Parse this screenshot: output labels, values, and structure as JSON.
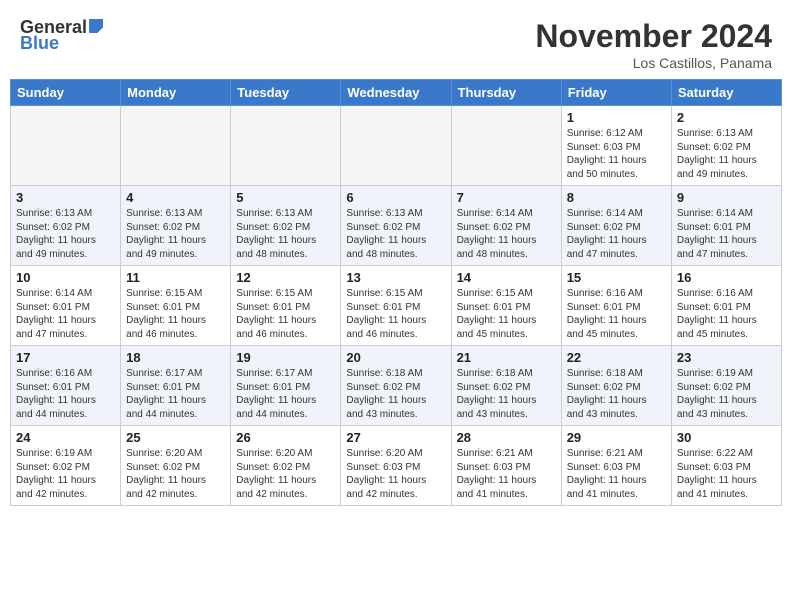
{
  "header": {
    "logo_general": "General",
    "logo_blue": "Blue",
    "month": "November 2024",
    "location": "Los Castillos, Panama"
  },
  "days_of_week": [
    "Sunday",
    "Monday",
    "Tuesday",
    "Wednesday",
    "Thursday",
    "Friday",
    "Saturday"
  ],
  "weeks": [
    [
      {
        "day": "",
        "info": ""
      },
      {
        "day": "",
        "info": ""
      },
      {
        "day": "",
        "info": ""
      },
      {
        "day": "",
        "info": ""
      },
      {
        "day": "",
        "info": ""
      },
      {
        "day": "1",
        "info": "Sunrise: 6:12 AM\nSunset: 6:03 PM\nDaylight: 11 hours\nand 50 minutes."
      },
      {
        "day": "2",
        "info": "Sunrise: 6:13 AM\nSunset: 6:02 PM\nDaylight: 11 hours\nand 49 minutes."
      }
    ],
    [
      {
        "day": "3",
        "info": "Sunrise: 6:13 AM\nSunset: 6:02 PM\nDaylight: 11 hours\nand 49 minutes."
      },
      {
        "day": "4",
        "info": "Sunrise: 6:13 AM\nSunset: 6:02 PM\nDaylight: 11 hours\nand 49 minutes."
      },
      {
        "day": "5",
        "info": "Sunrise: 6:13 AM\nSunset: 6:02 PM\nDaylight: 11 hours\nand 48 minutes."
      },
      {
        "day": "6",
        "info": "Sunrise: 6:13 AM\nSunset: 6:02 PM\nDaylight: 11 hours\nand 48 minutes."
      },
      {
        "day": "7",
        "info": "Sunrise: 6:14 AM\nSunset: 6:02 PM\nDaylight: 11 hours\nand 48 minutes."
      },
      {
        "day": "8",
        "info": "Sunrise: 6:14 AM\nSunset: 6:02 PM\nDaylight: 11 hours\nand 47 minutes."
      },
      {
        "day": "9",
        "info": "Sunrise: 6:14 AM\nSunset: 6:01 PM\nDaylight: 11 hours\nand 47 minutes."
      }
    ],
    [
      {
        "day": "10",
        "info": "Sunrise: 6:14 AM\nSunset: 6:01 PM\nDaylight: 11 hours\nand 47 minutes."
      },
      {
        "day": "11",
        "info": "Sunrise: 6:15 AM\nSunset: 6:01 PM\nDaylight: 11 hours\nand 46 minutes."
      },
      {
        "day": "12",
        "info": "Sunrise: 6:15 AM\nSunset: 6:01 PM\nDaylight: 11 hours\nand 46 minutes."
      },
      {
        "day": "13",
        "info": "Sunrise: 6:15 AM\nSunset: 6:01 PM\nDaylight: 11 hours\nand 46 minutes."
      },
      {
        "day": "14",
        "info": "Sunrise: 6:15 AM\nSunset: 6:01 PM\nDaylight: 11 hours\nand 45 minutes."
      },
      {
        "day": "15",
        "info": "Sunrise: 6:16 AM\nSunset: 6:01 PM\nDaylight: 11 hours\nand 45 minutes."
      },
      {
        "day": "16",
        "info": "Sunrise: 6:16 AM\nSunset: 6:01 PM\nDaylight: 11 hours\nand 45 minutes."
      }
    ],
    [
      {
        "day": "17",
        "info": "Sunrise: 6:16 AM\nSunset: 6:01 PM\nDaylight: 11 hours\nand 44 minutes."
      },
      {
        "day": "18",
        "info": "Sunrise: 6:17 AM\nSunset: 6:01 PM\nDaylight: 11 hours\nand 44 minutes."
      },
      {
        "day": "19",
        "info": "Sunrise: 6:17 AM\nSunset: 6:01 PM\nDaylight: 11 hours\nand 44 minutes."
      },
      {
        "day": "20",
        "info": "Sunrise: 6:18 AM\nSunset: 6:02 PM\nDaylight: 11 hours\nand 43 minutes."
      },
      {
        "day": "21",
        "info": "Sunrise: 6:18 AM\nSunset: 6:02 PM\nDaylight: 11 hours\nand 43 minutes."
      },
      {
        "day": "22",
        "info": "Sunrise: 6:18 AM\nSunset: 6:02 PM\nDaylight: 11 hours\nand 43 minutes."
      },
      {
        "day": "23",
        "info": "Sunrise: 6:19 AM\nSunset: 6:02 PM\nDaylight: 11 hours\nand 43 minutes."
      }
    ],
    [
      {
        "day": "24",
        "info": "Sunrise: 6:19 AM\nSunset: 6:02 PM\nDaylight: 11 hours\nand 42 minutes."
      },
      {
        "day": "25",
        "info": "Sunrise: 6:20 AM\nSunset: 6:02 PM\nDaylight: 11 hours\nand 42 minutes."
      },
      {
        "day": "26",
        "info": "Sunrise: 6:20 AM\nSunset: 6:02 PM\nDaylight: 11 hours\nand 42 minutes."
      },
      {
        "day": "27",
        "info": "Sunrise: 6:20 AM\nSunset: 6:03 PM\nDaylight: 11 hours\nand 42 minutes."
      },
      {
        "day": "28",
        "info": "Sunrise: 6:21 AM\nSunset: 6:03 PM\nDaylight: 11 hours\nand 41 minutes."
      },
      {
        "day": "29",
        "info": "Sunrise: 6:21 AM\nSunset: 6:03 PM\nDaylight: 11 hours\nand 41 minutes."
      },
      {
        "day": "30",
        "info": "Sunrise: 6:22 AM\nSunset: 6:03 PM\nDaylight: 11 hours\nand 41 minutes."
      }
    ]
  ]
}
